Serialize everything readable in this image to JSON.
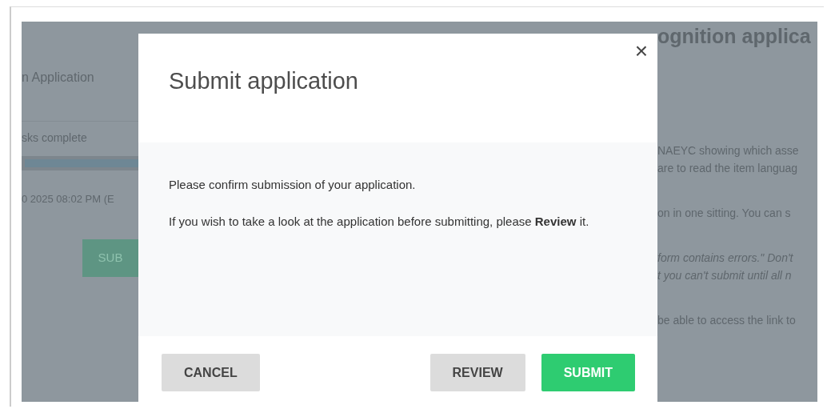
{
  "background": {
    "sidebar": {
      "heading": "n Application",
      "progress_label": "sks complete",
      "progress": {
        "level": 1
      },
      "date": "0 2025 08:02 PM (E",
      "button": "SUB"
    },
    "main": {
      "title": "ognition applica",
      "paragraphs": [
        {
          "italic": false,
          "lines": [
            "NAEYC showing which asse",
            "are to read the item languag"
          ]
        },
        {
          "italic": false,
          "lines": [
            "on in one sitting. You can s"
          ]
        },
        {
          "italic": true,
          "lines": [
            "form contains errors.\" Don't",
            "t you can't submit until all n"
          ]
        },
        {
          "italic": false,
          "lines": [
            "be able to access the link to"
          ]
        }
      ]
    }
  },
  "modal": {
    "title": "Submit application",
    "close": "×",
    "paragraphs": [
      "Please confirm submission of your application.",
      "If you wish to take a look at the application before submitting, please **Review** it."
    ],
    "buttons": [
      {
        "label": "CANCEL",
        "kind": "secondary"
      },
      {
        "label": "REVIEW",
        "kind": "secondary"
      },
      {
        "label": "SUBMIT",
        "kind": "primary"
      }
    ]
  }
}
